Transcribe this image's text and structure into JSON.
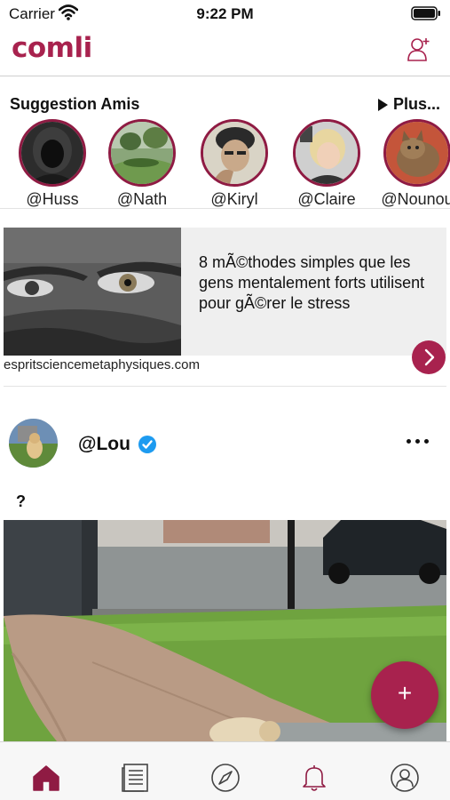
{
  "status_bar": {
    "carrier": "Carrier",
    "time": "9:22 PM"
  },
  "header": {
    "logo": "comli"
  },
  "suggestions": {
    "title": "Suggestion Amis",
    "more_label": "Plus...",
    "friends": [
      {
        "handle": "@Huss"
      },
      {
        "handle": "@Nath"
      },
      {
        "handle": "@Kiryl"
      },
      {
        "handle": "@Claire"
      },
      {
        "handle": "@Nounou"
      }
    ]
  },
  "article": {
    "title": "8 mÃ©thodes simples que les gens mentalement forts utilisent pour gÃ©rer le stress",
    "source": "espritsciencemetaphysiques.com"
  },
  "post": {
    "username": "@Lou",
    "text": "?"
  },
  "fab": {
    "label": "+"
  },
  "colors": {
    "brand": "#a8224e",
    "avatar_ring": "#8f1b43",
    "verified": "#1d9bf0"
  },
  "tabbar": {
    "tabs": [
      {
        "icon": "home-icon",
        "active": true
      },
      {
        "icon": "news-icon",
        "active": false
      },
      {
        "icon": "compass-icon",
        "active": false
      },
      {
        "icon": "bell-icon",
        "active": false
      },
      {
        "icon": "profile-icon",
        "active": false
      }
    ]
  }
}
